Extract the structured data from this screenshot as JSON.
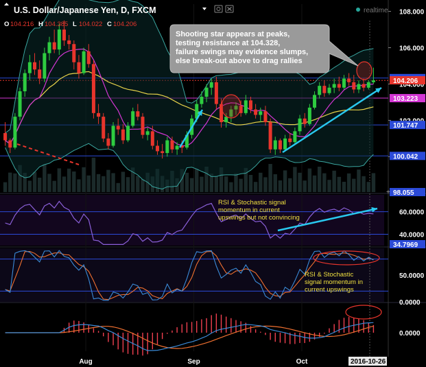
{
  "title": "U.S. Dollar/Japanese Yen, D, FXCM",
  "realtime_label": "realtime",
  "ohlc": [
    {
      "key": "O",
      "value": "104.216"
    },
    {
      "key": "H",
      "value": "104.385"
    },
    {
      "key": "L",
      "value": "104.022"
    },
    {
      "key": "C",
      "value": "104.206"
    }
  ],
  "icons": [
    "dropdown-triangle-icon",
    "settings-gear-icon",
    "close-x-icon",
    "realtime-dot-icon"
  ],
  "colors": {
    "up": "#26a69a",
    "up_candle": "#2ecc40",
    "down": "#e8352c",
    "bollinger": "#3aa6a0",
    "ma_fast": "#d436d4",
    "ma_slow": "#e8d34a",
    "trend_arrow": "#29c8ee",
    "resistance": "#2b4ad8",
    "callout_bg": "#9a9a9a",
    "rsi": "#8a5fd8",
    "stoch_k": "#3b8bd8",
    "stoch_d": "#f07030",
    "macd_hist": "#f04050"
  },
  "annotations": {
    "main_callout": [
      "Shooting star appears at peaks,",
      "testing resistance at 104.328,",
      "failure swings may evidence slumps,",
      "else break-out above to drag rallies"
    ],
    "rsi_note": [
      "RSI & Stochastic signal",
      "momentum in current",
      "upswings but not convincing"
    ],
    "stoch_note": [
      "RSI & Stochastic",
      "signal momentum in",
      "current upswings"
    ]
  },
  "chart_data": [
    {
      "type": "candlestick",
      "panel": "price",
      "title": "U.S. Dollar/Japanese Yen, D, FXCM",
      "yaxis_ticks": [
        "108.000",
        "106.000",
        "104.000",
        "102.000",
        "100.000"
      ],
      "price_labels": [
        {
          "text": "104.328",
          "color": "#2b4ad8"
        },
        {
          "text": "104.206",
          "color": "#e8352c"
        },
        {
          "text": "103.223",
          "color": "#d436d4"
        },
        {
          "text": "101.747",
          "color": "#2b4ad8"
        },
        {
          "text": "100.042",
          "color": "#2b4ad8"
        },
        {
          "text": "98.055",
          "color": "#2b4ad8"
        }
      ],
      "horizontal_levels": [
        104.328,
        103.223,
        101.747,
        100.042
      ],
      "ylim": [
        98.05,
        108.4
      ],
      "x_labels": [
        "Aug",
        "Sep",
        "Oct"
      ],
      "last_date": "2016-10-26",
      "candles": [
        {
          "o": 101.3,
          "h": 101.9,
          "l": 100.6,
          "c": 100.9
        },
        {
          "o": 100.9,
          "h": 101.0,
          "l": 100.2,
          "c": 100.5
        },
        {
          "o": 100.5,
          "h": 102.4,
          "l": 100.4,
          "c": 102.2
        },
        {
          "o": 102.2,
          "h": 103.8,
          "l": 102.0,
          "c": 103.6
        },
        {
          "o": 103.6,
          "h": 104.8,
          "l": 103.3,
          "c": 104.6
        },
        {
          "o": 104.6,
          "h": 105.6,
          "l": 104.2,
          "c": 105.2
        },
        {
          "o": 105.2,
          "h": 105.7,
          "l": 104.5,
          "c": 104.8
        },
        {
          "o": 104.8,
          "h": 105.3,
          "l": 104.0,
          "c": 104.3
        },
        {
          "o": 104.3,
          "h": 106.0,
          "l": 104.1,
          "c": 105.7
        },
        {
          "o": 105.7,
          "h": 106.6,
          "l": 105.3,
          "c": 106.3
        },
        {
          "o": 106.3,
          "h": 107.0,
          "l": 105.7,
          "c": 105.9
        },
        {
          "o": 105.9,
          "h": 107.3,
          "l": 105.6,
          "c": 107.0
        },
        {
          "o": 107.0,
          "h": 107.5,
          "l": 106.1,
          "c": 106.4
        },
        {
          "o": 106.4,
          "h": 106.7,
          "l": 105.9,
          "c": 106.2
        },
        {
          "o": 106.2,
          "h": 106.4,
          "l": 104.8,
          "c": 105.2
        },
        {
          "o": 105.2,
          "h": 105.6,
          "l": 104.3,
          "c": 104.6
        },
        {
          "o": 104.6,
          "h": 106.0,
          "l": 104.5,
          "c": 105.8
        },
        {
          "o": 105.8,
          "h": 106.2,
          "l": 104.9,
          "c": 105.1
        },
        {
          "o": 105.1,
          "h": 105.3,
          "l": 102.1,
          "c": 102.4
        },
        {
          "o": 102.4,
          "h": 102.9,
          "l": 101.8,
          "c": 102.2
        },
        {
          "o": 102.2,
          "h": 102.4,
          "l": 100.8,
          "c": 101.0
        },
        {
          "o": 101.0,
          "h": 101.3,
          "l": 100.4,
          "c": 100.6
        },
        {
          "o": 100.6,
          "h": 101.9,
          "l": 100.5,
          "c": 101.7
        },
        {
          "o": 101.7,
          "h": 102.1,
          "l": 101.2,
          "c": 101.5
        },
        {
          "o": 101.5,
          "h": 101.8,
          "l": 100.7,
          "c": 100.9
        },
        {
          "o": 100.9,
          "h": 101.9,
          "l": 100.8,
          "c": 101.7
        },
        {
          "o": 101.7,
          "h": 102.7,
          "l": 101.6,
          "c": 102.5
        },
        {
          "o": 102.5,
          "h": 102.9,
          "l": 102.0,
          "c": 102.2
        },
        {
          "o": 102.2,
          "h": 102.4,
          "l": 101.0,
          "c": 101.2
        },
        {
          "o": 101.2,
          "h": 101.6,
          "l": 100.9,
          "c": 101.4
        },
        {
          "o": 101.4,
          "h": 101.7,
          "l": 100.4,
          "c": 100.6
        },
        {
          "o": 100.6,
          "h": 100.9,
          "l": 100.1,
          "c": 100.3
        },
        {
          "o": 100.3,
          "h": 100.7,
          "l": 99.9,
          "c": 100.2
        },
        {
          "o": 100.2,
          "h": 101.1,
          "l": 100.0,
          "c": 100.9
        },
        {
          "o": 100.9,
          "h": 101.1,
          "l": 100.2,
          "c": 100.4
        },
        {
          "o": 100.4,
          "h": 100.8,
          "l": 100.1,
          "c": 100.6
        },
        {
          "o": 100.6,
          "h": 100.9,
          "l": 100.2,
          "c": 100.5
        },
        {
          "o": 100.5,
          "h": 101.4,
          "l": 100.4,
          "c": 101.2
        },
        {
          "o": 101.2,
          "h": 102.3,
          "l": 101.0,
          "c": 102.1
        },
        {
          "o": 102.1,
          "h": 103.1,
          "l": 101.9,
          "c": 102.9
        },
        {
          "o": 102.9,
          "h": 103.6,
          "l": 102.7,
          "c": 103.3
        },
        {
          "o": 103.3,
          "h": 104.0,
          "l": 103.0,
          "c": 103.8
        },
        {
          "o": 103.8,
          "h": 104.3,
          "l": 103.4,
          "c": 104.1
        },
        {
          "o": 104.1,
          "h": 104.4,
          "l": 102.6,
          "c": 102.9
        },
        {
          "o": 102.9,
          "h": 103.2,
          "l": 101.6,
          "c": 101.9
        },
        {
          "o": 101.9,
          "h": 102.4,
          "l": 101.6,
          "c": 102.2
        },
        {
          "o": 102.2,
          "h": 102.8,
          "l": 101.9,
          "c": 102.6
        },
        {
          "o": 102.6,
          "h": 103.0,
          "l": 102.3,
          "c": 102.8
        },
        {
          "o": 102.8,
          "h": 103.1,
          "l": 102.2,
          "c": 102.4
        },
        {
          "o": 102.4,
          "h": 103.4,
          "l": 102.3,
          "c": 103.1
        },
        {
          "o": 103.1,
          "h": 103.3,
          "l": 102.4,
          "c": 102.6
        },
        {
          "o": 102.6,
          "h": 102.9,
          "l": 102.1,
          "c": 102.3
        },
        {
          "o": 102.3,
          "h": 102.7,
          "l": 101.9,
          "c": 102.5
        },
        {
          "o": 102.5,
          "h": 102.8,
          "l": 101.7,
          "c": 101.9
        },
        {
          "o": 101.9,
          "h": 102.1,
          "l": 100.2,
          "c": 100.4
        },
        {
          "o": 100.4,
          "h": 101.1,
          "l": 100.1,
          "c": 100.9
        },
        {
          "o": 100.9,
          "h": 101.0,
          "l": 100.2,
          "c": 100.4
        },
        {
          "o": 100.4,
          "h": 101.2,
          "l": 100.3,
          "c": 101.0
        },
        {
          "o": 101.0,
          "h": 101.3,
          "l": 100.6,
          "c": 100.8
        },
        {
          "o": 100.8,
          "h": 101.6,
          "l": 100.7,
          "c": 101.4
        },
        {
          "o": 101.4,
          "h": 102.3,
          "l": 101.2,
          "c": 102.1
        },
        {
          "o": 102.1,
          "h": 102.4,
          "l": 101.6,
          "c": 101.8
        },
        {
          "o": 101.8,
          "h": 102.9,
          "l": 101.7,
          "c": 102.7
        },
        {
          "o": 102.7,
          "h": 103.6,
          "l": 102.6,
          "c": 103.4
        },
        {
          "o": 103.4,
          "h": 104.1,
          "l": 103.2,
          "c": 103.9
        },
        {
          "o": 103.9,
          "h": 104.2,
          "l": 103.3,
          "c": 103.5
        },
        {
          "o": 103.5,
          "h": 104.0,
          "l": 103.4,
          "c": 103.8
        },
        {
          "o": 103.8,
          "h": 104.3,
          "l": 103.5,
          "c": 104.0
        },
        {
          "o": 104.0,
          "h": 104.4,
          "l": 103.6,
          "c": 103.8
        },
        {
          "o": 103.8,
          "h": 104.5,
          "l": 103.7,
          "c": 104.3
        },
        {
          "o": 104.3,
          "h": 104.6,
          "l": 103.9,
          "c": 104.1
        },
        {
          "o": 104.1,
          "h": 104.5,
          "l": 103.5,
          "c": 103.7
        },
        {
          "o": 103.7,
          "h": 104.2,
          "l": 103.5,
          "c": 104.0
        },
        {
          "o": 104.0,
          "h": 104.3,
          "l": 103.6,
          "c": 103.8
        },
        {
          "o": 103.8,
          "h": 104.2,
          "l": 103.7,
          "c": 104.1
        },
        {
          "o": 104.1,
          "h": 104.9,
          "l": 104.0,
          "c": 104.2
        }
      ]
    },
    {
      "type": "line",
      "panel": "rsi",
      "ylim": [
        30,
        75
      ],
      "yaxis_ticks": [
        "60.0000",
        "40.0000"
      ],
      "price_labels": [
        "34.7969"
      ]
    },
    {
      "type": "line",
      "panel": "stochastic",
      "ylim": [
        0,
        100
      ],
      "yaxis_ticks": [
        "50.0000",
        "0.0000"
      ]
    },
    {
      "type": "bar",
      "panel": "macd",
      "yaxis_ticks": [
        "0.0000"
      ]
    }
  ]
}
